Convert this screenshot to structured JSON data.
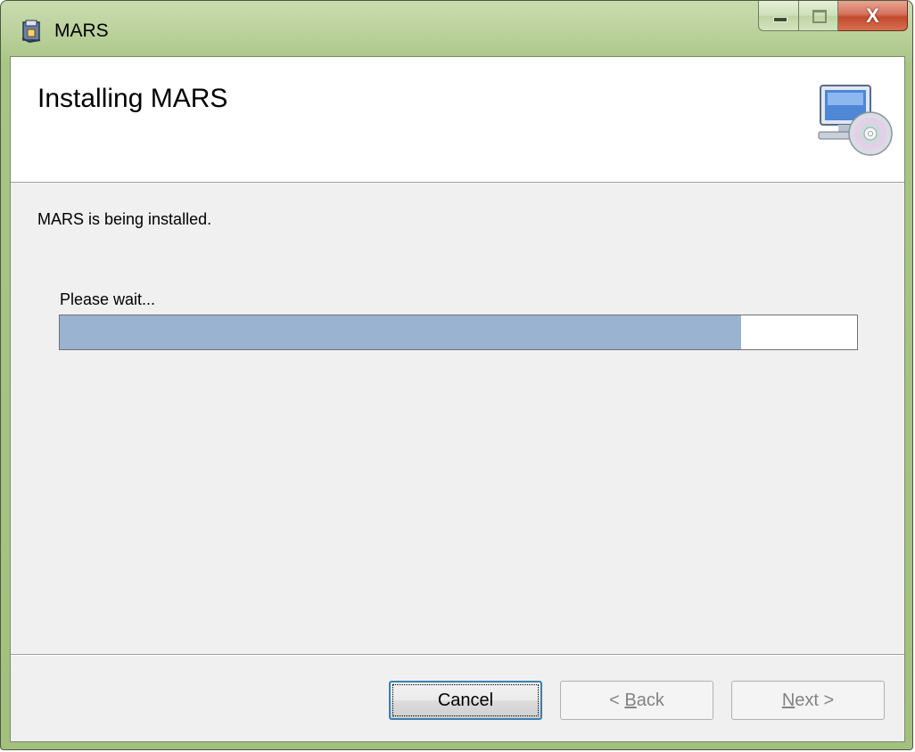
{
  "window": {
    "title": "MARS",
    "close_glyph": "X",
    "title_icon": "installer-package-icon"
  },
  "banner": {
    "title": "Installing MARS",
    "icon": "computer-disc-icon"
  },
  "body": {
    "status": "MARS is being installed.",
    "wait_label": "Please wait...",
    "progress_fraction": 0.855
  },
  "buttons": {
    "cancel": "Cancel",
    "back_prefix": "< ",
    "back_mnemonic": "B",
    "back_rest": "ack",
    "next_mnemonic": "N",
    "next_rest": "ext >"
  },
  "colors": {
    "progress_fill": "#9ab3d1",
    "frame": "#b9d09a"
  }
}
